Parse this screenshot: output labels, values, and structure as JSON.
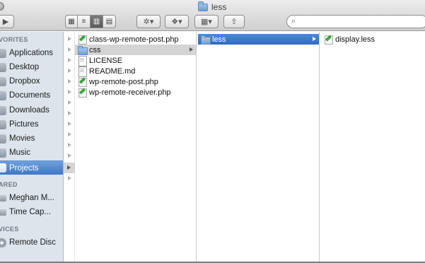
{
  "window": {
    "title": "less",
    "search": {
      "placeholder": "",
      "value": ""
    }
  },
  "toolbar": {
    "nav_forward": "▶",
    "view_icons": "▦",
    "view_list": "≡",
    "view_columns": "▥",
    "view_coverflow": "▤",
    "action": "✲▾",
    "dropbox": "❖▾",
    "arrange": "▦▾",
    "share": "⇪",
    "search_glyph": "⌕"
  },
  "sidebar": {
    "sections": [
      {
        "heading": "VORITES"
      },
      {
        "heading": "ARED"
      },
      {
        "heading": "VICES"
      }
    ],
    "items": [
      {
        "label": "Applications",
        "icon": "applications-icon"
      },
      {
        "label": "Desktop",
        "icon": "desktop-icon"
      },
      {
        "label": "Dropbox",
        "icon": "dropbox-icon"
      },
      {
        "label": "Documents",
        "icon": "documents-icon"
      },
      {
        "label": "Downloads",
        "icon": "downloads-icon"
      },
      {
        "label": "Pictures",
        "icon": "pictures-icon"
      },
      {
        "label": "Movies",
        "icon": "movies-icon"
      },
      {
        "label": "Music",
        "icon": "music-icon"
      },
      {
        "label": "Projects",
        "icon": "folder-icon",
        "selected": true
      },
      {
        "label": "Meghan M...",
        "icon": "computer-icon"
      },
      {
        "label": "Time Cap...",
        "icon": "time-capsule-icon"
      },
      {
        "label": "Remote Disc",
        "icon": "disc-icon"
      }
    ]
  },
  "columns": [
    {
      "items": [
        {
          "name": "class-wp-remote-post.php",
          "type": "php"
        },
        {
          "name": "css",
          "type": "folder",
          "selected": "inactive"
        },
        {
          "name": "LICENSE",
          "type": "doc"
        },
        {
          "name": "README.md",
          "type": "doc"
        },
        {
          "name": "wp-remote-post.php",
          "type": "php"
        },
        {
          "name": "wp-remote-receiver.php",
          "type": "php"
        }
      ]
    },
    {
      "items": [
        {
          "name": "less",
          "type": "folder",
          "selected": "active"
        }
      ]
    },
    {
      "items": [
        {
          "name": "display.less",
          "type": "less"
        }
      ]
    }
  ],
  "colors": {
    "sidebar_bg": "#dde4ec",
    "selection_blue": "#3f78c8",
    "selection_grey": "#d4d4d4"
  }
}
